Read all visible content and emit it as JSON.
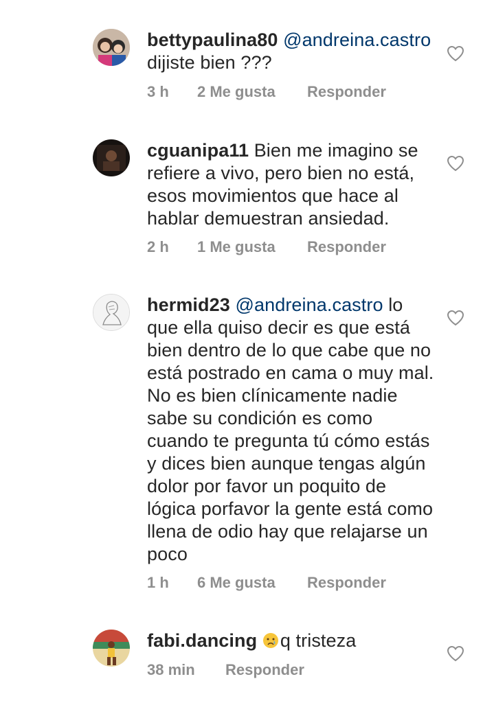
{
  "comments": [
    {
      "username": "bettypaulina80",
      "mention": "@andreina.castro",
      "text": "dijiste bien ???",
      "time": "3 h",
      "likes": "2 Me gusta",
      "reply": "Responder"
    },
    {
      "username": "cguanipa11",
      "mention": "",
      "text": "Bien me imagino se refiere a vivo, pero bien no está, esos movimientos que hace al hablar demuestran ansiedad.",
      "time": "2 h",
      "likes": "1 Me gusta",
      "reply": "Responder"
    },
    {
      "username": "hermid23",
      "mention": "@andreina.castro",
      "text": "lo que ella quiso decir es que está bien dentro de lo que cabe que no está postrado en cama o muy mal. No es bien clínicamente nadie sabe su condición es como cuando te pregunta tú cómo estás y dices bien aunque tengas algún dolor por favor un poquito de lógica porfavor la gente está como llena de odio hay que relajarse un poco",
      "time": "1 h",
      "likes": "6 Me gusta",
      "reply": "Responder"
    },
    {
      "username": "fabi.dancing",
      "mention": "",
      "emoji": "crying-face-emoji",
      "text": "q tristeza",
      "time": "38 min",
      "likes": "",
      "reply": "Responder"
    }
  ],
  "colors": {
    "text": "#262626",
    "mention": "#00376b",
    "meta": "#8e8e8e",
    "heart": "#8e8e8e"
  }
}
